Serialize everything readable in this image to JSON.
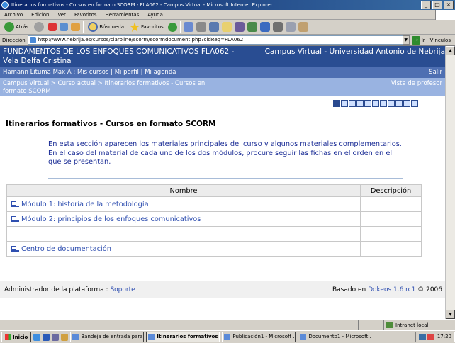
{
  "window": {
    "title": "Itinerarios formativos - Cursos en formato SCORM - FLA062 - Campus Virtual - Microsoft Internet Explorer",
    "controls": {
      "minimize": "_",
      "maximize": "□",
      "close": "×"
    }
  },
  "menu": [
    "Archivo",
    "Edición",
    "Ver",
    "Favoritos",
    "Herramientas",
    "Ayuda"
  ],
  "toolbar": {
    "back_label": "Atrás",
    "search_label": "Búsqueda",
    "favorites_label": "Favoritos"
  },
  "address": {
    "label": "Dirección",
    "url": "http://www.nebrija.es/cursos/claroline/scorm/scormdocument.php?cidReq=FLA062",
    "go_label": "Ir",
    "links_label": "Vínculos"
  },
  "header": {
    "course_title": "FUNDAMENTOS DE LOS ENFOQUES COMUNICATIVOS FLA062 -",
    "teacher": "Vela Delfa Cristina",
    "campus": "Campus Virtual - Universidad Antonio de Nebrija",
    "user": "Hamann Lituma Max A",
    "sep": " : ",
    "nav": [
      "Mis cursos",
      "Mi perfil",
      "Mi agenda"
    ],
    "logout": "Salir",
    "breadcrumb": "Campus Virtual > Curso actual > Itinerarios formativos - Cursos en formato SCORM",
    "teacher_view": "Vista de profesor"
  },
  "page": {
    "title": "Itinerarios formativos - Cursos en formato SCORM",
    "intro": "En esta sección aparecen los materiales principales del curso y algunos materiales complementarios. En el caso del material de cada uno de los dos módulos, procure seguir las fichas en el orden en el que se presentan."
  },
  "table": {
    "headers": [
      "Nombre",
      "Descripción"
    ],
    "rows": [
      {
        "name": "Módulo 1: historia de la metodología",
        "description": ""
      },
      {
        "name": "Módulo 2: principios de los enfoques comunicativos",
        "description": ""
      },
      {
        "name": "",
        "description": ""
      },
      {
        "name": "Centro de documentación",
        "description": ""
      }
    ]
  },
  "footer": {
    "admin_label": "Administrador de la plataforma :",
    "admin_link": "Soporte",
    "based_on": "Basado en",
    "platform": "Dokeos 1.6 rc1",
    "copyright": "© 2006"
  },
  "status": {
    "zone": "Intranet local"
  },
  "taskbar": {
    "start": "Inicio",
    "tasks": [
      "Bandeja de entrada para ...",
      "Itinerarios formativos ...",
      "Publicación1 - Microsoft ...",
      "Documento1 - Microsoft ..."
    ],
    "clock": "17:20"
  }
}
